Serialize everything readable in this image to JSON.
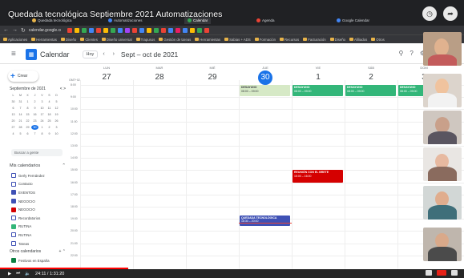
{
  "video": {
    "title": "Quedada tecnológica Septiembre 2021 Automatizaciones",
    "time": "24:11 / 1:31:20",
    "progress_fraction": 0.276
  },
  "browser": {
    "tabs": [
      {
        "label": "Quedada tecnológica",
        "color": "#e8b44a"
      },
      {
        "label": "Automatizaciones",
        "color": "#4285f4"
      },
      {
        "label": "Calendar",
        "color": "#34a853"
      },
      {
        "label": "Agenda",
        "color": "#ea4335"
      },
      {
        "label": "Google Calendar",
        "color": "#4285f4"
      }
    ],
    "url": "calendar.google.co",
    "bookmarks": [
      "Aplicaciones",
      "Herramientas",
      "Diseño",
      "Clientes",
      "Diseño universal",
      "Trapusos",
      "Gestión de tareas",
      "Herramientas",
      "Sabias + ADS",
      "Formación",
      "Recursos",
      "Facturación",
      "Diseño",
      "Afiliados",
      "Otros"
    ]
  },
  "calendar": {
    "app_title": "Calendar",
    "today_label": "Hoy",
    "range_label": "Sept – oct de 2021",
    "gmt_label": "GMT+02",
    "days": [
      {
        "dow": "LUN",
        "num": "27",
        "today": false
      },
      {
        "dow": "MAR",
        "num": "28",
        "today": false
      },
      {
        "dow": "MIÉ",
        "num": "29",
        "today": false
      },
      {
        "dow": "JUE",
        "num": "30",
        "today": true
      },
      {
        "dow": "VIE",
        "num": "1",
        "today": false
      },
      {
        "dow": "SÁB",
        "num": "2",
        "today": false
      },
      {
        "dow": "DOM",
        "num": "3",
        "today": false
      }
    ],
    "hours": [
      "8:00",
      "9:00",
      "10:00",
      "11:00",
      "12:00",
      "13:00",
      "14:00",
      "15:00",
      "16:00",
      "17:00",
      "18:00",
      "19:00",
      "20:00",
      "21:00",
      "22:00"
    ],
    "events": [
      {
        "day": 3,
        "start": 8.0,
        "end": 8.9,
        "title": "DESAYUNO",
        "time": "08:00 – 09:00",
        "color": "#d6e9c6",
        "text_color": "#3c4043"
      },
      {
        "day": 4,
        "start": 8.0,
        "end": 8.9,
        "title": "DESAYUNO",
        "time": "08:00 – 09:00",
        "color": "#33b679",
        "text_color": "#ffffff"
      },
      {
        "day": 5,
        "start": 8.0,
        "end": 8.9,
        "title": "DESAYUNO",
        "time": "08:00 – 09:00",
        "color": "#33b679",
        "text_color": "#ffffff"
      },
      {
        "day": 6,
        "start": 8.0,
        "end": 8.9,
        "title": "DESAYUNO",
        "time": "08:00 – 09:00",
        "color": "#33b679",
        "text_color": "#ffffff"
      },
      {
        "day": 4,
        "start": 15.0,
        "end": 16.0,
        "title": "REUNIÓN CON EL BRETE",
        "time": "15:00 – 16:00",
        "color": "#d50000",
        "text_color": "#ffffff"
      },
      {
        "day": 3,
        "start": 18.7,
        "end": 19.6,
        "title": "QUEDADA TECNOLÓGICA",
        "time": "18:30 – 20:00",
        "color": "#3f51b5",
        "text_color": "#ffffff"
      }
    ],
    "now_hour": 19.3
  },
  "sidebar": {
    "create_label": "Crear",
    "mini_month_title": "Septiembre de 2021",
    "mini_nav": "<  >",
    "mini_weekdays": [
      "L",
      "M",
      "X",
      "J",
      "V",
      "S",
      "D"
    ],
    "mini_days": [
      "30",
      "31",
      "1",
      "2",
      "3",
      "4",
      "5",
      "6",
      "7",
      "8",
      "9",
      "10",
      "11",
      "12",
      "13",
      "14",
      "15",
      "16",
      "17",
      "18",
      "19",
      "20",
      "21",
      "22",
      "23",
      "24",
      "25",
      "26",
      "27",
      "28",
      "29",
      "30",
      "1",
      "2",
      "3",
      "4",
      "5",
      "6",
      "7",
      "8",
      "9",
      "10"
    ],
    "mini_selected_index": 31,
    "search_people": "Buscar a gente",
    "my_calendars_title": "Mis calendarios",
    "calendars": [
      {
        "label": "Gerly Fernández",
        "color": "#ffffff",
        "checked": false
      },
      {
        "label": "Contacto",
        "color": "#ffffff",
        "checked": false
      },
      {
        "label": "EVENTOS",
        "color": "#3f51b5",
        "checked": true
      },
      {
        "label": "NEGOCIO",
        "color": "#3f51b5",
        "checked": true
      },
      {
        "label": "NEGOCIO",
        "color": "#d50000",
        "checked": true
      },
      {
        "label": "Recordatorios",
        "color": "#ffffff",
        "checked": false
      },
      {
        "label": "RUTINA",
        "color": "#33b679",
        "checked": true
      },
      {
        "label": "RUTINA",
        "color": "#ffffff",
        "checked": false
      },
      {
        "label": "Tareas",
        "color": "#ffffff",
        "checked": false
      }
    ],
    "other_calendars_title": "Otros calendarios",
    "other_calendars_actions": "+  ⌃",
    "other_calendars": [
      {
        "label": "Festivos en España",
        "color": "#0b8043",
        "checked": true
      }
    ]
  },
  "icons": {
    "menu": "hamburger-icon",
    "search": "search-icon",
    "help": "help-icon",
    "settings": "gear-icon"
  }
}
